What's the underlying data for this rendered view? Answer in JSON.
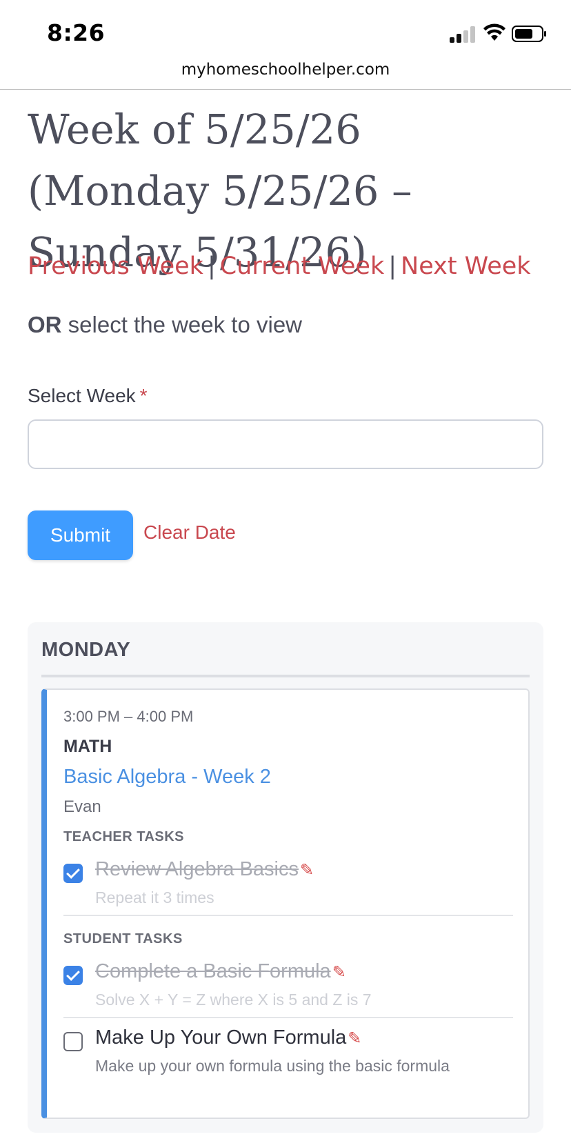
{
  "status_bar": {
    "time": "8:26"
  },
  "browser": {
    "url": "myhomeschoolhelper.com"
  },
  "page": {
    "title": "Week of 5/25/26 (Monday 5/25/26 – Sunday 5/31/26)",
    "nav": {
      "previous": "Previous Week",
      "current": "Current Week",
      "next": "Next Week",
      "separator": "|"
    },
    "or_bold": "OR",
    "or_rest": " select the week to view",
    "field": {
      "label": "Select Week",
      "required_mark": "*",
      "value": ""
    },
    "submit_label": "Submit",
    "clear_label": "Clear Date"
  },
  "day": {
    "name": "MONDAY",
    "event": {
      "time": "3:00 PM – 4:00 PM",
      "subject": "MATH",
      "lesson": "Basic Algebra - Week 2",
      "student": "Evan",
      "teacher_tasks_label": "TEACHER TASKS",
      "teacher_tasks": [
        {
          "title": "Review Algebra Basics",
          "note": "Repeat it 3 times",
          "done": true
        }
      ],
      "student_tasks_label": "STUDENT TASKS",
      "student_tasks": [
        {
          "title": "Complete a Basic Formula",
          "note": "Solve X + Y = Z where X is 5 and Z is 7",
          "done": true
        },
        {
          "title": "Make Up Your Own Formula",
          "note": "Make up your own formula using the basic formula",
          "done": false
        }
      ],
      "edit_glyph": "✎"
    }
  },
  "colors": {
    "accent_blue": "#4a90e2",
    "button_blue": "#3f9cff",
    "link_red": "#c9484f",
    "text_dark": "#4d4f5c"
  }
}
